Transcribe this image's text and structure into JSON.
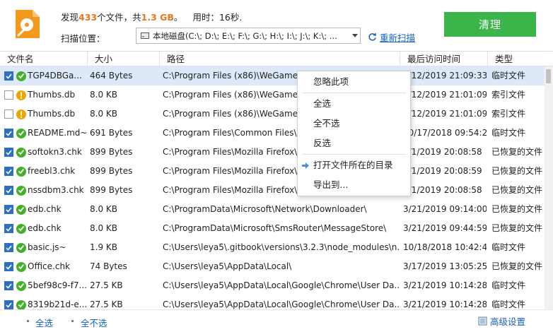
{
  "header": {
    "summary_prefix": "发现",
    "file_count": "433",
    "summary_mid": "个文件，共",
    "total_size": "1.3 GB",
    "summary_suffix": "。",
    "time_label": "用时：",
    "time_value": "16秒.",
    "scan_label": "扫描位置：",
    "scan_location": "本地磁盘(C:\\; D:\\; E:\\; F:\\; G:\\; H:\\; I:\\; J:\\; K:\\; ...",
    "rescan_label": "重新扫描",
    "clean_button": "清理"
  },
  "columns": [
    "文件名",
    "大小",
    "路径",
    "最后访问时间",
    "类型"
  ],
  "rows": [
    {
      "checked": true,
      "status": "ok",
      "name": "TGP4DBGa...",
      "size": "464 Bytes",
      "path": "C:\\Program Files (x86)\\WeGame\\...",
      "date": "3/12/2019 21:09:33",
      "type": "临时文件",
      "selected": true
    },
    {
      "checked": false,
      "status": "warn",
      "name": "Thumbs.db",
      "size": "8.0 KB",
      "path": "C:\\Program Files (x86)\\WeGame\\...",
      "date": "3/12/2019 21:01:09",
      "type": "索引文件",
      "selected": false
    },
    {
      "checked": false,
      "status": "warn",
      "name": "Thumbs.db",
      "size": "8.0 KB",
      "path": "C:\\Program Files (x86)\\WeGame\\...",
      "date": "3/12/2019 21:01:09",
      "type": "索引文件",
      "selected": false
    },
    {
      "checked": true,
      "status": "ok",
      "name": "README.md~",
      "size": "691 Bytes",
      "path": "C:\\Program Files\\Common Files\\...",
      "date": "10/17/2018 09:54:27",
      "type": "临时文件",
      "selected": false
    },
    {
      "checked": true,
      "status": "ok",
      "name": "softokn3.chk",
      "size": "899 Bytes",
      "path": "C:\\Program Files\\Mozilla Firefox\\...",
      "date": "3/1/2019 20:08:58",
      "type": "已恢复的文件",
      "selected": false
    },
    {
      "checked": true,
      "status": "ok",
      "name": "freebl3.chk",
      "size": "899 Bytes",
      "path": "C:\\Program Files\\Mozilla Firefox\\...",
      "date": "3/1/2019 20:08:59",
      "type": "已恢复的文件",
      "selected": false
    },
    {
      "checked": true,
      "status": "ok",
      "name": "nssdbm3.chk",
      "size": "899 Bytes",
      "path": "C:\\Program Files\\Mozilla Firefox\\...",
      "date": "3/1/2019 20:08:58",
      "type": "已恢复的文件",
      "selected": false
    },
    {
      "checked": true,
      "status": "ok",
      "name": "edb.chk",
      "size": "8.0 KB",
      "path": "C:\\ProgramData\\Microsoft\\Network\\Downloader\\",
      "date": "3/21/2019 09:14:00",
      "type": "已恢复的文件",
      "selected": false
    },
    {
      "checked": true,
      "status": "ok",
      "name": "edb.chk",
      "size": "8.0 KB",
      "path": "C:\\ProgramData\\Microsoft\\SmsRouter\\MessageStore\\",
      "date": "3/21/2019 09:44:59",
      "type": "已恢复的文件",
      "selected": false
    },
    {
      "checked": true,
      "status": "ok",
      "name": "basic.js~",
      "size": "1.9 KB",
      "path": "C:\\Users\\leya5\\.gitbook\\versions\\3.2.3\\node_modules\\n...",
      "date": "10/18/2018 10:42:42",
      "type": "临时文件",
      "selected": false
    },
    {
      "checked": true,
      "status": "ok",
      "name": "Office.chk",
      "size": "74 Bytes",
      "path": "C:\\Users\\leya5\\AppData\\Local\\",
      "date": "3/17/2019 13:05:25",
      "type": "已恢复的文件",
      "selected": false
    },
    {
      "checked": true,
      "status": "ok",
      "name": "5bef98c9-f7...",
      "size": "27.5 KB",
      "path": "C:\\Users\\leya5\\AppData\\Local\\Google\\Chrome\\User Da...",
      "date": "3/21/2019 10:14:28",
      "type": "临时文件",
      "selected": false
    },
    {
      "checked": true,
      "status": "ok",
      "name": "8319b21d-e...",
      "size": "27.5 KB",
      "path": "C:\\Users\\leya5\\AppData\\Local\\Google\\Chrome\\User Da...",
      "date": "3/21/2019 10:14:28",
      "type": "临时文件",
      "selected": false
    }
  ],
  "footer": {
    "select_all": "全选",
    "select_none": "全不选",
    "advanced": "高级设置"
  },
  "context_menu": {
    "ignore": "忽略此项",
    "select_all": "全选",
    "select_none": "全不选",
    "invert": "反选",
    "open_folder": "打开文件所在的目录",
    "export": "导出到..."
  },
  "colors": {
    "accent_green": "#3bb54a",
    "link_blue": "#1560bd",
    "highlight_orange": "#e8771a",
    "selected_row": "#dde9f8"
  }
}
